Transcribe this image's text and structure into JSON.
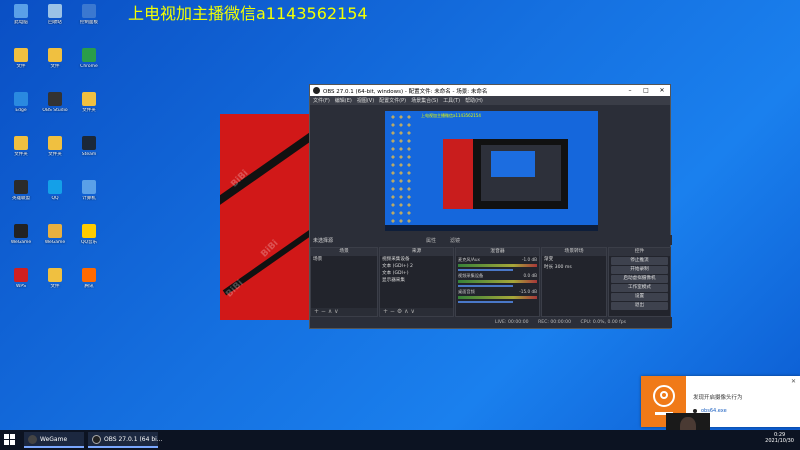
{
  "watermark": "上电视加主播微信a1143562154",
  "desktop_icons": [
    {
      "label": "此电脑",
      "color": "#5aa0e8"
    },
    {
      "label": "回收站",
      "color": "#9bc2e6"
    },
    {
      "label": "控制面板",
      "color": "#3b78d0"
    },
    {
      "label": "文件",
      "color": "#f0c040"
    },
    {
      "label": "文件",
      "color": "#f0c040"
    },
    {
      "label": "Chrome",
      "color": "#2a9d4a"
    },
    {
      "label": "Edge",
      "color": "#2a8ae0"
    },
    {
      "label": "OBS Studio",
      "color": "#333333"
    },
    {
      "label": "文件夹",
      "color": "#f0c040"
    },
    {
      "label": "文件夹",
      "color": "#f0c040"
    },
    {
      "label": "文件夹",
      "color": "#f0c040"
    },
    {
      "label": "Steam",
      "color": "#1b2838"
    },
    {
      "label": "英雄联盟",
      "color": "#2b2b2b"
    },
    {
      "label": "QQ",
      "color": "#14a0e8"
    },
    {
      "label": "计算机",
      "color": "#5aa0e8"
    },
    {
      "label": "WeGame",
      "color": "#222222"
    },
    {
      "label": "WeGame",
      "color": "#e8b040"
    },
    {
      "label": "QQ音乐",
      "color": "#ffcc00"
    },
    {
      "label": "WPS",
      "color": "#d02020"
    },
    {
      "label": "文件",
      "color": "#f0c040"
    },
    {
      "label": "腾讯",
      "color": "#ff6a00"
    }
  ],
  "obs": {
    "title": "OBS 27.0.1 (64-bit, windows) - 配置文件: 未命名 - 场景: 未命名",
    "menu": [
      "文件(F)",
      "编辑(E)",
      "视图(V)",
      "配置文件(P)",
      "场景集合(S)",
      "工具(T)",
      "帮助(H)"
    ],
    "current_scene_label": "未选择源",
    "properties_label": "属性",
    "filters_label": "滤镜",
    "docks": {
      "scenes": {
        "title": "场景",
        "items": [
          "场景"
        ]
      },
      "sources": {
        "title": "来源",
        "items": [
          "视频采集设备",
          "文本 (GDI+) 2",
          "文本 (GDI+)",
          "显示器采集"
        ]
      },
      "mixer": {
        "title": "混音器",
        "rows": [
          {
            "name": "麦克风/Aux",
            "db": "-1.0 dB"
          },
          {
            "name": "视频采集设备",
            "db": "0.0 dB"
          },
          {
            "name": "桌面音频",
            "db": "-15.0 dB"
          }
        ]
      },
      "transitions": {
        "title": "场景转场",
        "type": "渐变",
        "duration_label": "时长",
        "duration": "300 ms"
      },
      "controls": {
        "title": "控件",
        "buttons": [
          "停止推流",
          "开始录制",
          "启动虚拟摄像机",
          "工作室模式",
          "设置",
          "退出"
        ]
      }
    },
    "status": {
      "live": "LIVE: 00:00:00",
      "rec": "REC: 00:00:00",
      "cpu": "CPU: 0.0%, 0.00 fps"
    }
  },
  "toast": {
    "title": "发现开启摄像头行为",
    "app": "obs64.exe"
  },
  "taskbar": {
    "items": [
      "WeGame",
      "OBS 27.0.1 (64 bi..."
    ],
    "time": "0:29",
    "date": "2021/10/30"
  }
}
